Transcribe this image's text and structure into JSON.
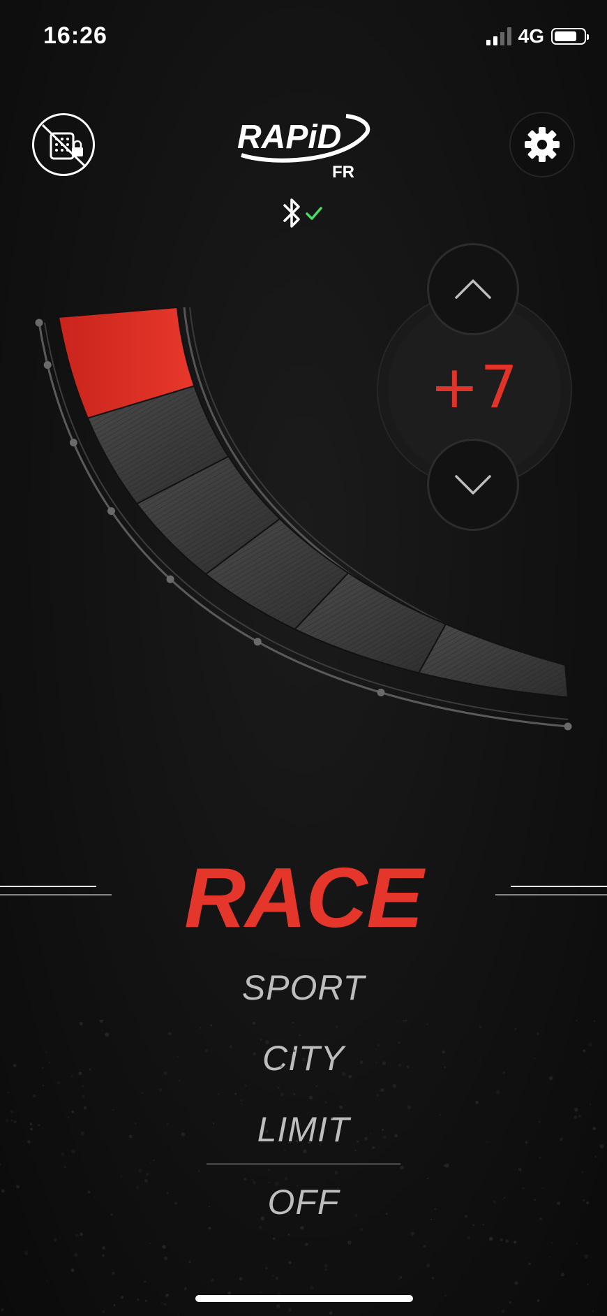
{
  "status_bar": {
    "time": "16:26",
    "network": "4G",
    "signal_bars": 2,
    "battery_level": 0.68
  },
  "header": {
    "left_icon": "pedal-lock-disabled-icon",
    "logo_text": "RAPiD",
    "logo_subtext": "FR",
    "settings_icon": "gear-icon",
    "connection_icon": "bluetooth-icon",
    "connection_status_icon": "check-icon",
    "connection_status_color": "#4cd964"
  },
  "tuning": {
    "level": "+7",
    "up_icon": "chevron-up-icon",
    "down_icon": "chevron-down-icon",
    "gauge_fill_segments": 1,
    "gauge_total_segments": 6
  },
  "modes": {
    "active": "RACE",
    "options": [
      "SPORT",
      "CITY",
      "LIMIT",
      "OFF"
    ],
    "active_color": "#e4362b"
  }
}
